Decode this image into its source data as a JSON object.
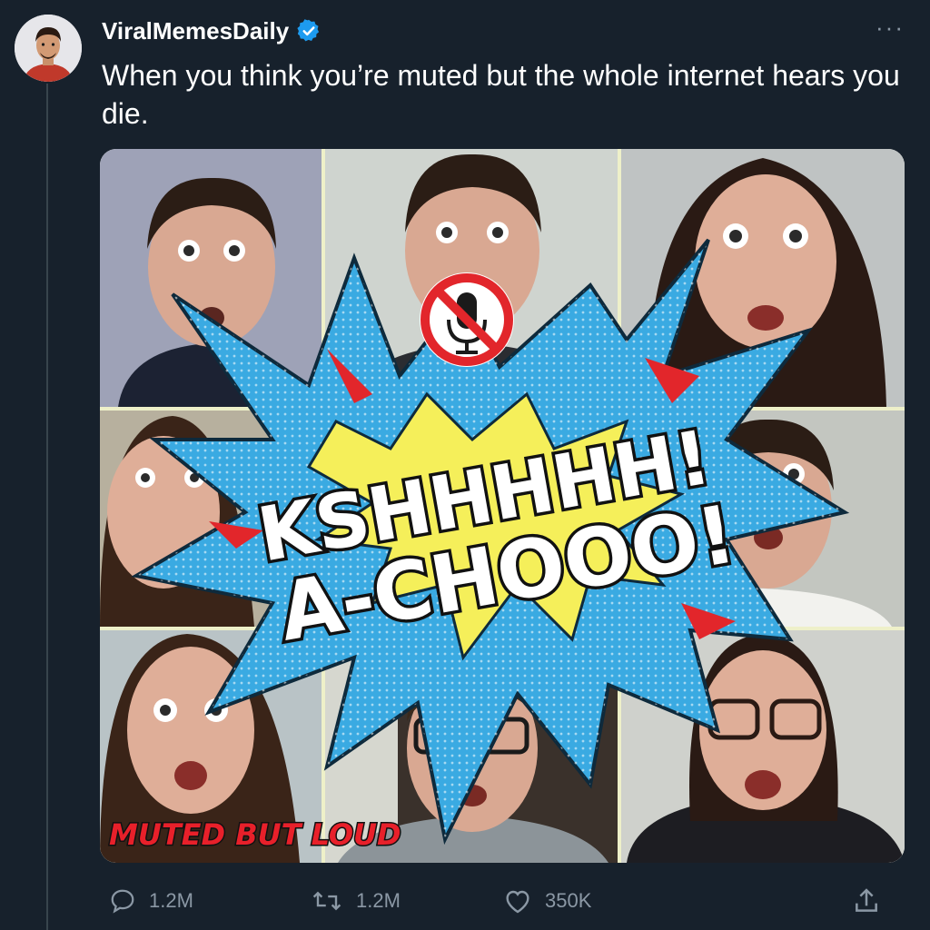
{
  "author": {
    "display_name": "ViralMemesDaily",
    "verified_icon": "verified-badge-icon",
    "more_icon": "more-options-icon",
    "more_glyph": "···"
  },
  "tweet": {
    "text": "When you think you’re muted but the whole internet hears you die."
  },
  "media": {
    "burst_line_1": "KSHHHHH!",
    "burst_line_2": "A-CHOOO!",
    "corner_caption": "MUTED BUT LOUD",
    "muted_icon": "muted-microphone-icon"
  },
  "actions": {
    "reply_count": "1.2M",
    "retweet_count": "1.2M",
    "like_count": "350K",
    "share_icon": "share-icon"
  },
  "colors": {
    "background": "#17212c",
    "accent_blue": "#1d9bf0",
    "muted_text": "#8b98a5",
    "burst_blue": "#3aaae2",
    "burst_yellow": "#f5ef5a",
    "burst_red": "#e2262b",
    "caption_red": "#e8202a"
  }
}
